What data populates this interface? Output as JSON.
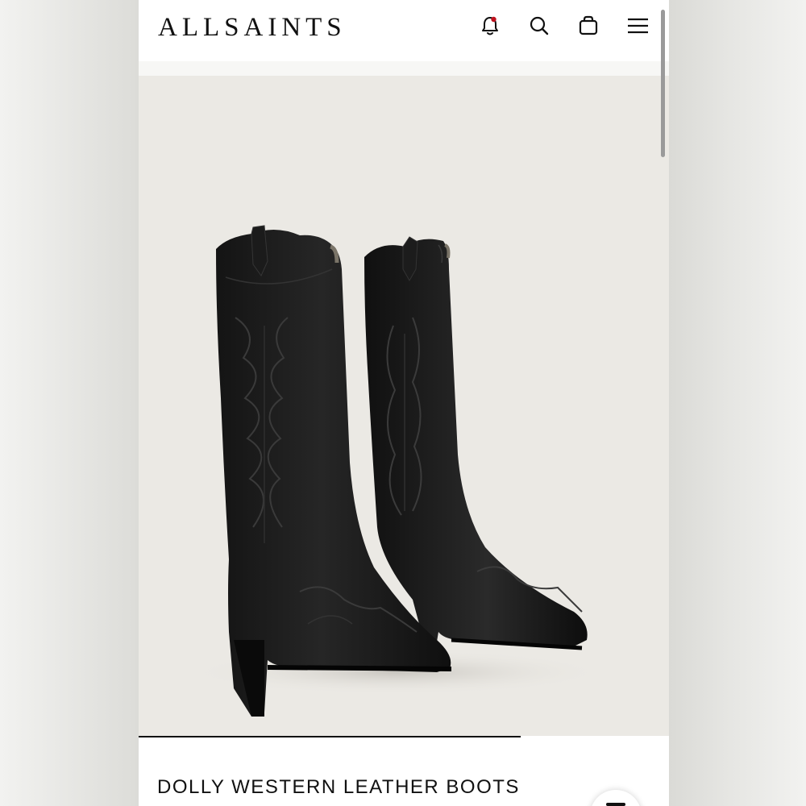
{
  "header": {
    "logo": "ALLSAINTS",
    "icons": [
      "notification-bell-icon",
      "search-icon",
      "shopping-bag-icon",
      "menu-icon"
    ],
    "notification_dot_color": "#c0121f"
  },
  "gallery": {
    "image_subject": "pair of black leather western boots with embroidered stitching",
    "background_color": "#ebe9e4",
    "progress_fraction": 0.72
  },
  "product": {
    "title": "DOLLY WESTERN LEATHER BOOTS"
  }
}
